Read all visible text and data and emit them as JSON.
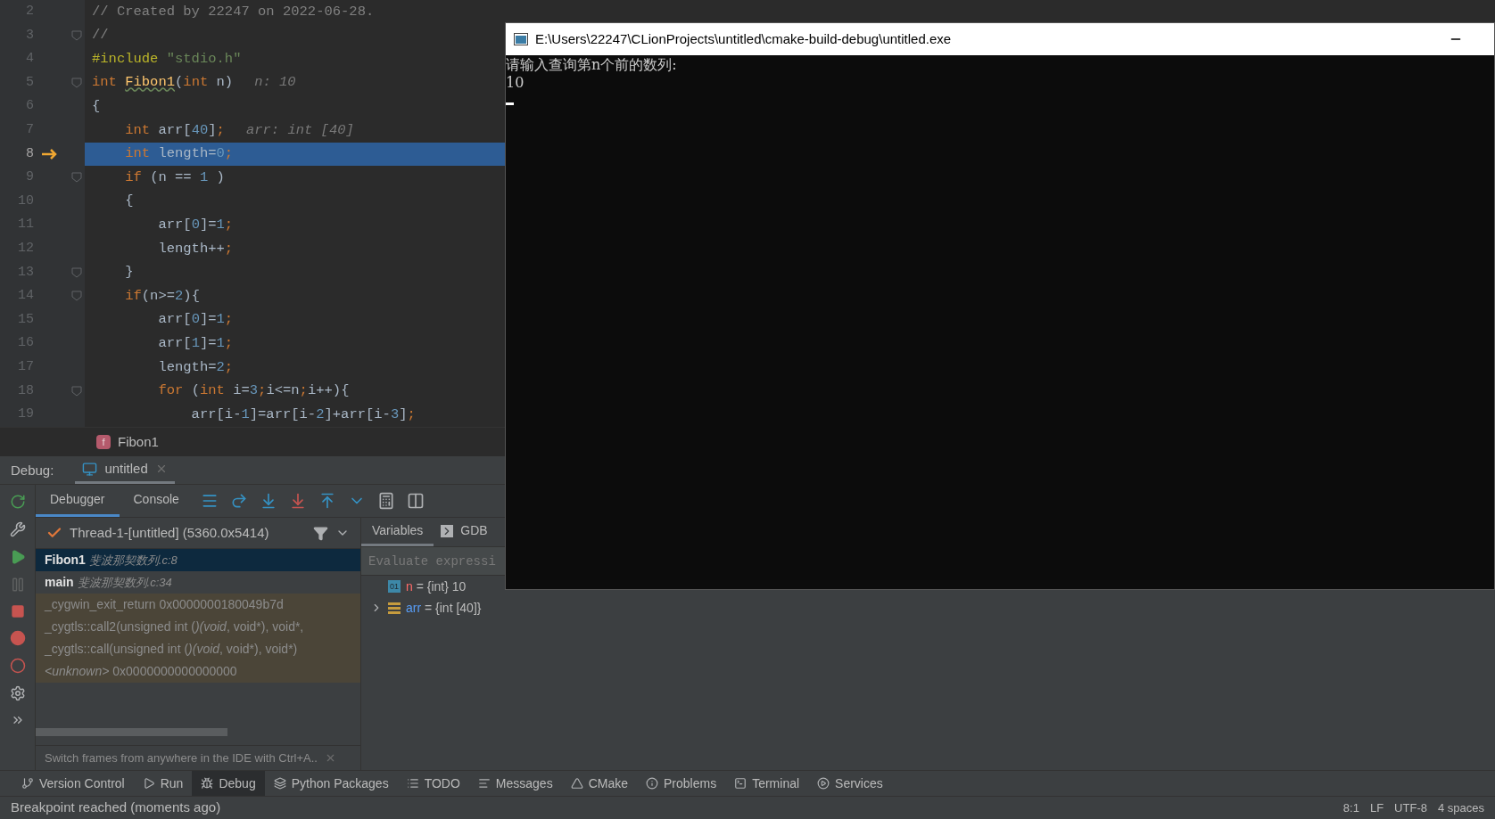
{
  "editor": {
    "lines": [
      {
        "number": "2",
        "current": false,
        "fold": false,
        "tokens": [
          {
            "kind": "comment",
            "text": "// Created by 22247 on 2022-06-28."
          }
        ]
      },
      {
        "number": "3",
        "current": false,
        "fold": true,
        "tokens": [
          {
            "kind": "comment",
            "text": "//"
          }
        ]
      },
      {
        "number": "4",
        "current": false,
        "fold": false,
        "tokens": [
          {
            "kind": "macro",
            "text": "#include "
          },
          {
            "kind": "string",
            "text": "\"stdio.h\""
          }
        ]
      },
      {
        "number": "5",
        "current": false,
        "fold": true,
        "tokens": [
          {
            "kind": "keyword",
            "text": "int "
          },
          {
            "kind": "function",
            "text": "Fibon1"
          },
          {
            "kind": "plain",
            "text": "("
          },
          {
            "kind": "keyword",
            "text": "int"
          },
          {
            "kind": "plain",
            "text": " n)"
          },
          {
            "kind": "hint",
            "text": "n: 10"
          }
        ]
      },
      {
        "number": "6",
        "current": false,
        "fold": false,
        "tokens": [
          {
            "kind": "plain",
            "text": "{"
          }
        ]
      },
      {
        "number": "7",
        "current": false,
        "fold": false,
        "tokens": [
          {
            "kind": "keyword",
            "text": "    int "
          },
          {
            "kind": "plain",
            "text": "arr["
          },
          {
            "kind": "number",
            "text": "40"
          },
          {
            "kind": "plain",
            "text": "]"
          },
          {
            "kind": "keyword",
            "text": ";"
          },
          {
            "kind": "hint",
            "text": "arr: int [40]"
          }
        ]
      },
      {
        "number": "8",
        "current": true,
        "fold": false,
        "tokens": [
          {
            "kind": "keyword",
            "text": "    int "
          },
          {
            "kind": "plain",
            "text": "length="
          },
          {
            "kind": "number",
            "text": "0"
          },
          {
            "kind": "keyword",
            "text": ";"
          }
        ]
      },
      {
        "number": "9",
        "current": false,
        "fold": true,
        "tokens": [
          {
            "kind": "keyword",
            "text": "    if "
          },
          {
            "kind": "plain",
            "text": "(n == "
          },
          {
            "kind": "number",
            "text": "1"
          },
          {
            "kind": "plain",
            "text": " )"
          }
        ]
      },
      {
        "number": "10",
        "current": false,
        "fold": false,
        "tokens": [
          {
            "kind": "plain",
            "text": "    {"
          }
        ]
      },
      {
        "number": "11",
        "current": false,
        "fold": false,
        "tokens": [
          {
            "kind": "plain",
            "text": "        arr["
          },
          {
            "kind": "number",
            "text": "0"
          },
          {
            "kind": "plain",
            "text": "]="
          },
          {
            "kind": "number",
            "text": "1"
          },
          {
            "kind": "keyword",
            "text": ";"
          }
        ]
      },
      {
        "number": "12",
        "current": false,
        "fold": false,
        "tokens": [
          {
            "kind": "plain",
            "text": "        length++"
          },
          {
            "kind": "keyword",
            "text": ";"
          }
        ]
      },
      {
        "number": "13",
        "current": false,
        "fold": true,
        "tokens": [
          {
            "kind": "plain",
            "text": "    }"
          }
        ]
      },
      {
        "number": "14",
        "current": false,
        "fold": true,
        "tokens": [
          {
            "kind": "keyword",
            "text": "    if"
          },
          {
            "kind": "plain",
            "text": "(n>="
          },
          {
            "kind": "number",
            "text": "2"
          },
          {
            "kind": "plain",
            "text": "){"
          }
        ]
      },
      {
        "number": "15",
        "current": false,
        "fold": false,
        "tokens": [
          {
            "kind": "plain",
            "text": "        arr["
          },
          {
            "kind": "number",
            "text": "0"
          },
          {
            "kind": "plain",
            "text": "]="
          },
          {
            "kind": "number",
            "text": "1"
          },
          {
            "kind": "keyword",
            "text": ";"
          }
        ]
      },
      {
        "number": "16",
        "current": false,
        "fold": false,
        "tokens": [
          {
            "kind": "plain",
            "text": "        arr["
          },
          {
            "kind": "number",
            "text": "1"
          },
          {
            "kind": "plain",
            "text": "]="
          },
          {
            "kind": "number",
            "text": "1"
          },
          {
            "kind": "keyword",
            "text": ";"
          }
        ]
      },
      {
        "number": "17",
        "current": false,
        "fold": false,
        "tokens": [
          {
            "kind": "plain",
            "text": "        length="
          },
          {
            "kind": "number",
            "text": "2"
          },
          {
            "kind": "keyword",
            "text": ";"
          }
        ]
      },
      {
        "number": "18",
        "current": false,
        "fold": true,
        "tokens": [
          {
            "kind": "keyword",
            "text": "        for "
          },
          {
            "kind": "plain",
            "text": "("
          },
          {
            "kind": "keyword",
            "text": "int "
          },
          {
            "kind": "plain",
            "text": "i="
          },
          {
            "kind": "number",
            "text": "3"
          },
          {
            "kind": "keyword",
            "text": ";"
          },
          {
            "kind": "plain",
            "text": "i<=n"
          },
          {
            "kind": "keyword",
            "text": ";"
          },
          {
            "kind": "plain",
            "text": "i++){"
          }
        ]
      },
      {
        "number": "19",
        "current": false,
        "fold": false,
        "tokens": [
          {
            "kind": "plain",
            "text": "            arr[i-"
          },
          {
            "kind": "number",
            "text": "1"
          },
          {
            "kind": "plain",
            "text": "]=arr[i-"
          },
          {
            "kind": "number",
            "text": "2"
          },
          {
            "kind": "plain",
            "text": "]+arr[i-"
          },
          {
            "kind": "number",
            "text": "3"
          },
          {
            "kind": "plain",
            "text": "]"
          },
          {
            "kind": "keyword",
            "text": ";"
          }
        ]
      }
    ]
  },
  "breadcrumb": {
    "icon_letter": "f",
    "label": "Fibon1"
  },
  "debug": {
    "label": "Debug:",
    "session_tab": "untitled",
    "tabs": [
      {
        "label": "Debugger",
        "selected": true
      },
      {
        "label": "Console",
        "selected": false
      }
    ],
    "thread": "Thread-1-[untitled] (5360.0x5414)",
    "frames": [
      {
        "kind": "source",
        "name": "Fibon1",
        "location": "斐波那契数列.c:8",
        "selected": true
      },
      {
        "kind": "source",
        "name": "main",
        "location": "斐波那契数列.c:34",
        "selected": false
      },
      {
        "kind": "library",
        "text": "_cygwin_exit_return 0x0000000180049b7d",
        "selected": false
      },
      {
        "kind": "library",
        "text": "_cygtls::call2(unsigned int (*)(void*, void*), void*,",
        "selected": false
      },
      {
        "kind": "library",
        "text": "_cygtls::call(unsigned int (*)(void*, void*), void*)",
        "selected": false
      },
      {
        "kind": "library",
        "text": "*<unknown>* 0x0000000000000000",
        "selected": false
      }
    ],
    "hint": "Switch frames from anywhere in the IDE with Ctrl+A..",
    "var_tabs": [
      {
        "label": "Variables",
        "selected": true
      },
      {
        "label": "GDB",
        "selected": false
      }
    ],
    "evaluate_placeholder": "Evaluate expressi",
    "variables": [
      {
        "kind": "primitive",
        "name": "n",
        "value": "= {int} 10",
        "type_badge": "01"
      },
      {
        "kind": "array",
        "name": "arr",
        "value": "= {int [40]}"
      }
    ]
  },
  "console": {
    "title": "E:\\Users\\22247\\CLionProjects\\untitled\\cmake-build-debug\\untitled.exe",
    "output": [
      "请输入查询第n个前的数列:",
      "10"
    ]
  },
  "tool_tabs": [
    {
      "kind": "vcs",
      "label": "Version Control",
      "selected": false
    },
    {
      "kind": "run",
      "label": "Run",
      "selected": false
    },
    {
      "kind": "debug",
      "label": "Debug",
      "selected": true
    },
    {
      "kind": "packages",
      "label": "Python Packages",
      "selected": false
    },
    {
      "kind": "todo",
      "label": "TODO",
      "selected": false
    },
    {
      "kind": "messages",
      "label": "Messages",
      "selected": false
    },
    {
      "kind": "cmake",
      "label": "CMake",
      "selected": false
    },
    {
      "kind": "problems",
      "label": "Problems",
      "selected": false
    },
    {
      "kind": "terminal",
      "label": "Terminal",
      "selected": false
    },
    {
      "kind": "services",
      "label": "Services",
      "selected": false
    }
  ],
  "status": {
    "message": "Breakpoint reached (moments ago)",
    "position": "8:1",
    "line_ending": "LF",
    "encoding": "UTF-8",
    "indent": "4 spaces"
  }
}
